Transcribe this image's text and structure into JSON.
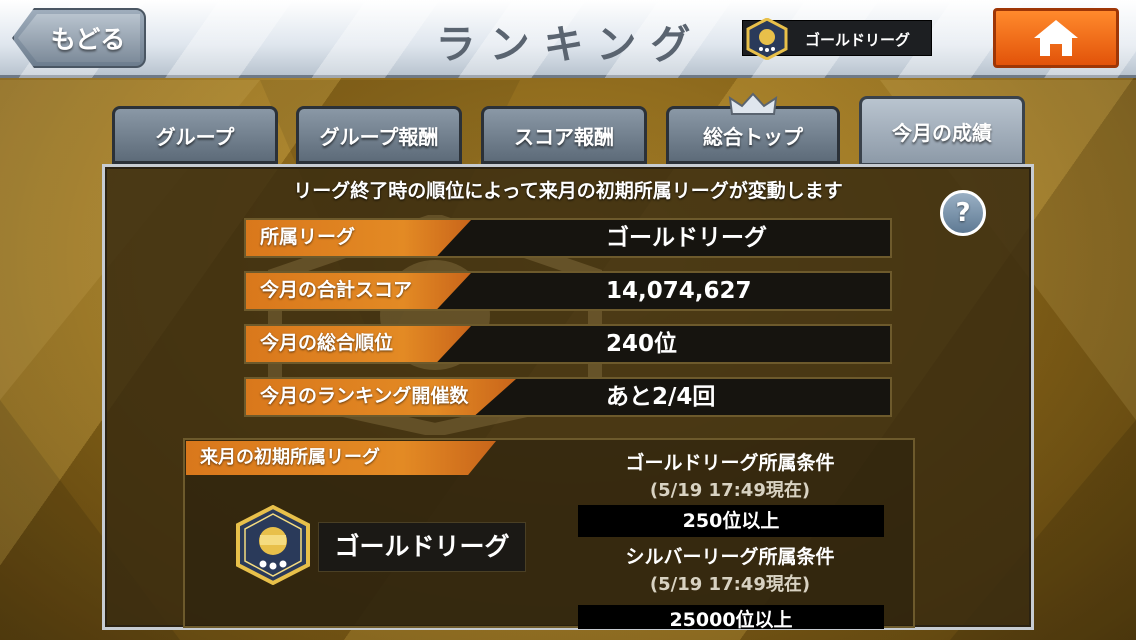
{
  "header": {
    "back_label": "もどる",
    "title": "ランキング",
    "league_badge": "ゴールドリーグ",
    "home_icon": "home-icon"
  },
  "tabs": [
    {
      "label": "グループ",
      "active": false
    },
    {
      "label": "グループ報酬",
      "active": false
    },
    {
      "label": "スコア報酬",
      "active": false
    },
    {
      "label": "総合トップ",
      "active": false
    },
    {
      "label": "今月の成績",
      "active": true
    }
  ],
  "panel": {
    "notice": "リーグ終了時の順位によって来月の初期所属リーグが変動します",
    "help_label": "?",
    "rows": [
      {
        "label": "所属リーグ",
        "value": "ゴールドリーグ"
      },
      {
        "label": "今月の合計スコア",
        "value": "14,074,627"
      },
      {
        "label": "今月の総合順位",
        "value": "240位"
      },
      {
        "label": "今月のランキング開催数",
        "value": "あと2/4回"
      }
    ],
    "next_month": {
      "label": "来月の初期所属リーグ",
      "league": "ゴールドリーグ",
      "conditions": [
        {
          "title": "ゴールドリーグ所属条件",
          "time": "(5/19 17:49現在)",
          "requirement": "250位以上"
        },
        {
          "title": "シルバーリーグ所属条件",
          "time": "(5/19 17:49現在)",
          "requirement": "25000位以上"
        }
      ]
    }
  },
  "colors": {
    "accent_orange": "#e38a24",
    "home_button": "#f07020",
    "panel_bg": "#3a2c10"
  }
}
